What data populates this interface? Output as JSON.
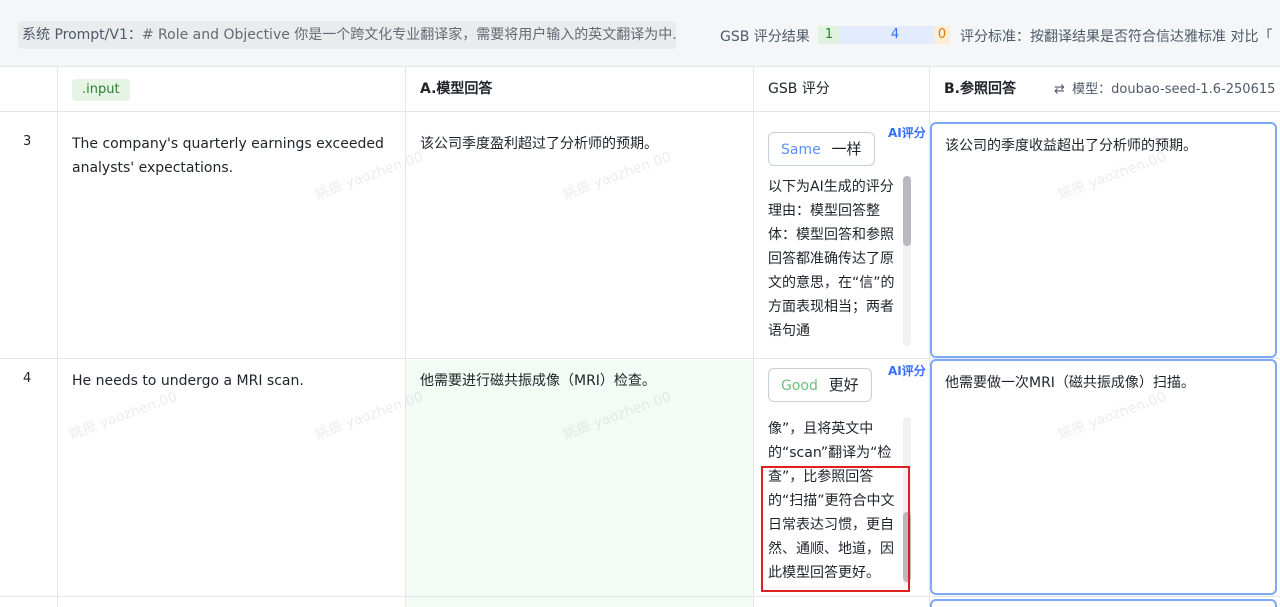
{
  "topbar": {
    "prompt_label": "系统 Prompt/V1：",
    "prompt_text": "# Role and Objective 你是一个跨文化专业翻译家，需要将用户输入的英文翻译为中...",
    "gsb_label": "GSB 评分结果",
    "gsb_good": "1",
    "gsb_same": "4",
    "gsb_bad": "0",
    "criteria_label": "评分标准：",
    "criteria_text": "按翻译结果是否符合信达雅标准 对比「"
  },
  "header": {
    "input_tag": ".input",
    "col_a": "A.模型回答",
    "col_gsb": "GSB 评分",
    "col_b": "B.参照回答",
    "model_icon": "swap-icon",
    "model_label": "模型：doubao-seed-1.6-250615"
  },
  "rows": [
    {
      "num": "3",
      "input": "The company's quarterly earnings exceeded analysts' expectations.",
      "model_answer": "该公司季度盈利超过了分析师的预期。",
      "ai_badge": "AI评分",
      "score_en": "Same",
      "score_zh": "一样",
      "reason": "以下为AI生成的评分理由：模型回答整体：模型回答和参照回答都准确传达了原文的意思，在“信”的方面表现相当；两者语句通",
      "reference": "该公司的季度收益超出了分析师的预期。"
    },
    {
      "num": "4",
      "input": "He needs to undergo a MRI scan.",
      "model_answer": "他需要进行磁共振成像（MRI）检查。",
      "ai_badge": "AI评分",
      "score_en": "Good",
      "score_zh": "更好",
      "reason": "像”，且将英文中的“scan”翻译为“检查”，比参照回答的“扫描”更符合中文日常表达习惯，更自然、通顺、地道，因此模型回答更好。",
      "reference": "他需要做一次MRI（磁共振成像）扫描。"
    }
  ],
  "watermark": "姚振 yaozhen.00"
}
